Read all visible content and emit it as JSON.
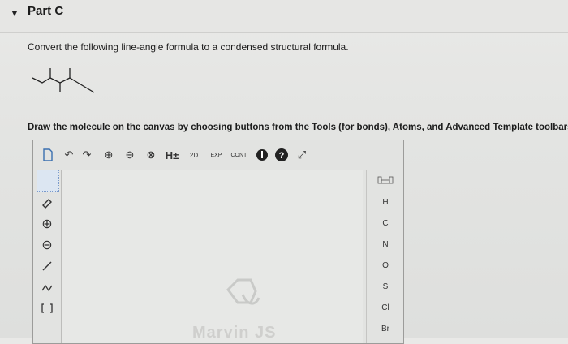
{
  "header": {
    "title": "Part C"
  },
  "question_text": "Convert the following line-angle formula to a condensed structural formula.",
  "instruction_text": "Draw the molecule on the canvas by choosing buttons from the Tools (for bonds), Atoms, and Advanced Template toolbars.",
  "toolbar_top": {
    "h_plus": "H±",
    "two_d": "2D",
    "exp": "EXP.",
    "cont": "CONT."
  },
  "atoms": [
    "H",
    "C",
    "N",
    "O",
    "S",
    "Cl",
    "Br"
  ],
  "watermark": "Marvin JS",
  "icons": {
    "caret": "caret-down-icon",
    "new_doc": "document-icon",
    "undo": "undo-icon",
    "redo": "redo-icon",
    "zoom_in": "zoom-in-icon",
    "zoom_out": "zoom-out-icon",
    "clear": "clear-icon",
    "info": "info-icon",
    "help": "help-icon",
    "expand": "expand-icon"
  }
}
